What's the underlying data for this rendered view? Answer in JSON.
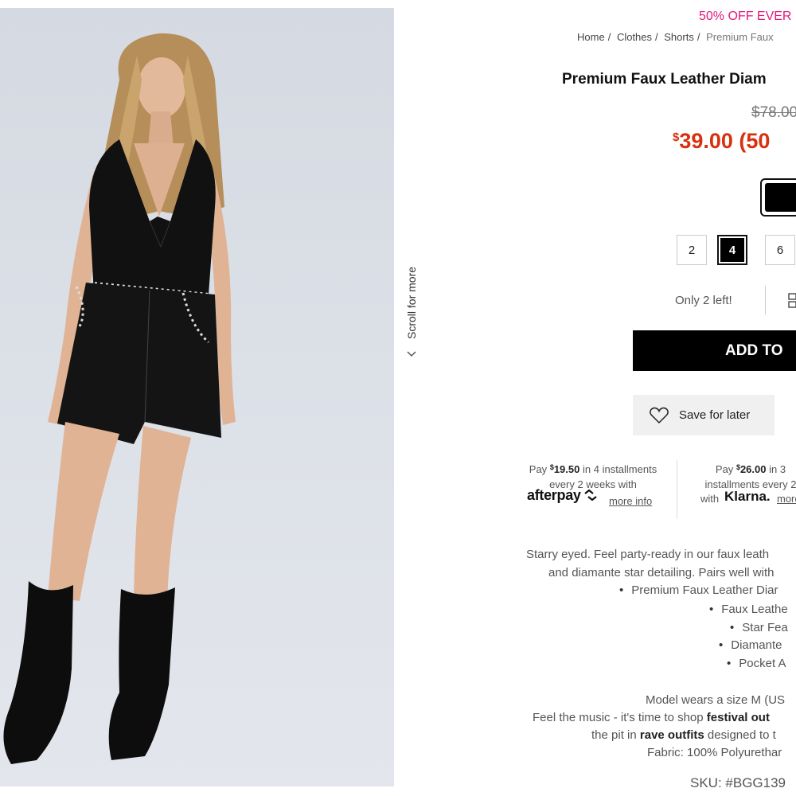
{
  "promo": "50% OFF EVER",
  "breadcrumb": [
    "Home",
    "Clothes",
    "Shorts",
    "Premium Faux"
  ],
  "product": {
    "title": "Premium Faux Leather Diam",
    "old_price": "$78.00",
    "new_price_currency": "$",
    "new_price": "39.00 (50",
    "selected_color": "#000000",
    "sizes": [
      "2",
      "4",
      "6"
    ],
    "selected_size": "4",
    "stock_text": "Only 2 left!"
  },
  "actions": {
    "add_to_bag": "ADD TO",
    "save_for_later": "Save for later"
  },
  "scroll_hint": "Scroll for more",
  "payments": {
    "afterpay": {
      "pre": "Pay",
      "currency": "$",
      "amount": "19.50",
      "line1_rest": "in 4 installments",
      "line2": "every 2 weeks with",
      "logo": "afterpay",
      "link": "more info"
    },
    "klarna": {
      "pre": "Pay",
      "currency": "$",
      "amount": "26.00",
      "line1_rest": "in 3",
      "line2": "installments every 2",
      "line3": "with",
      "logo": "Klarna.",
      "link": "more"
    }
  },
  "description": {
    "line1": "Starry eyed. Feel party-ready in our faux leath",
    "line2": "and diamante star detailing. Pairs well with",
    "bullets": [
      "Premium Faux Leather Diar",
      "Faux Leathe",
      "Star Fea",
      "Diamante",
      "Pocket A"
    ],
    "model": "Model wears a size M (US",
    "festival_pre": "Feel the music - it's time to shop",
    "festival_link": "festival out",
    "rave_pre": "the pit in",
    "rave_link": "rave outfits",
    "rave_post": "designed to t",
    "fabric": "Fabric: 100% Polyurethar",
    "sku": "SKU: #BGG139"
  },
  "colors": {
    "promo": "#e5197a",
    "sale_price": "#d9300f",
    "button": "#000000"
  }
}
